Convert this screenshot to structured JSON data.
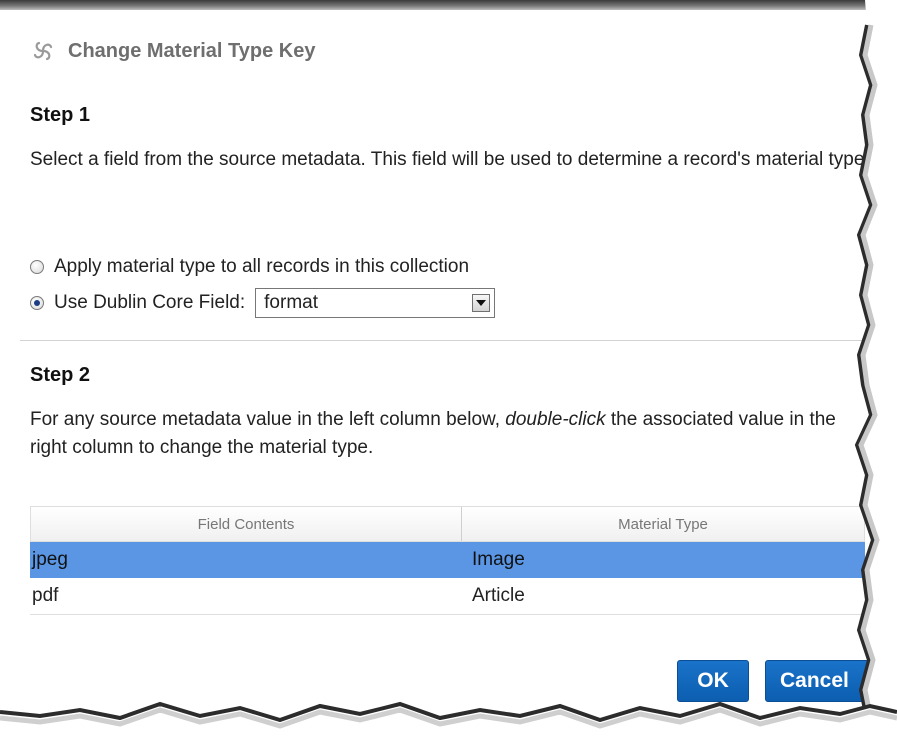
{
  "dialog": {
    "title": "Change Material Type Key",
    "title_icon": "swirl-icon",
    "step1": {
      "heading": "Step 1",
      "description": "Select a field from the source metadata. This field will be used to determine a record's material type.",
      "option_all": "Apply material type to all records in this collection",
      "option_dc": "Use Dublin Core Field:",
      "selected_option": "dublin-core-field",
      "dc_field_value": "format"
    },
    "step2": {
      "heading": "Step 2",
      "description_before": "For any source metadata value in the left column below, ",
      "description_em": "double-click",
      "description_after": " the associated value in the right column to change the material type."
    },
    "grid": {
      "columns": [
        "Field Contents",
        "Material Type"
      ],
      "rows": [
        {
          "field": "jpeg",
          "type": "Image",
          "selected": true
        },
        {
          "field": "pdf",
          "type": "Article",
          "selected": false
        }
      ]
    },
    "buttons": {
      "ok": "OK",
      "cancel": "Cancel"
    },
    "colors": {
      "selected_row": "#5a96e4",
      "button": "#1a73c9"
    }
  }
}
